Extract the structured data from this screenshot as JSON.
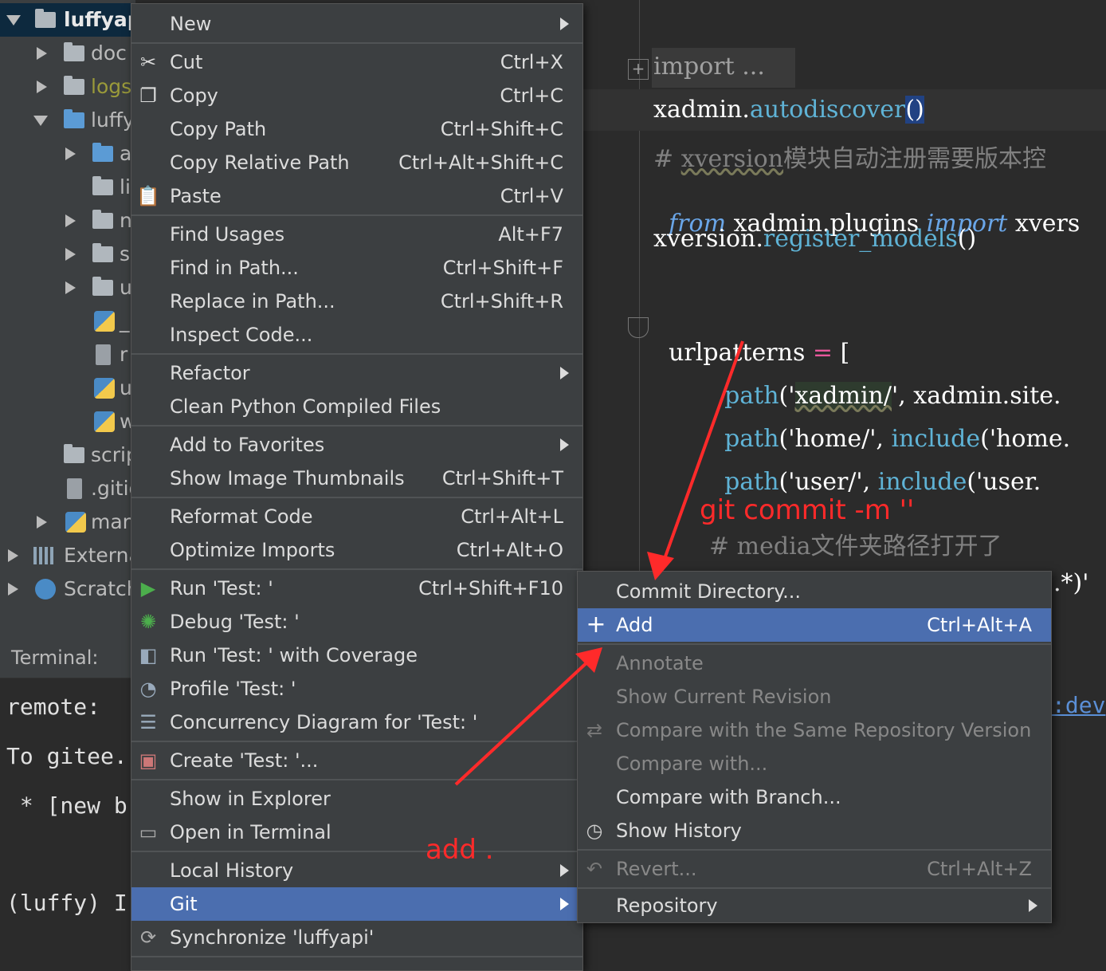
{
  "tree": {
    "root": "luffyap",
    "items": [
      "doc",
      "logs",
      "luffy",
      "a",
      "li",
      "n",
      "s",
      "u",
      "_",
      "r",
      "u",
      "w",
      "scrip",
      ".gitig",
      "man",
      "Externa",
      "Scratch"
    ]
  },
  "terminal": {
    "tab": "Terminal:",
    "lines": [
      "remote:",
      "To gitee.",
      " * [new b",
      "(luffy) I"
    ]
  },
  "editor": {
    "l1": "import ...",
    "l2a": "xadmin.",
    "l2b": "autodiscover",
    "l2c": "()",
    "l3a": "# ",
    "l3b": "xversion",
    "l3c": "模块自动注册需要版本控",
    "l4a": "from",
    "l4b": " xadmin.plugins ",
    "l4c": "import",
    "l4d": " xvers",
    "l5a": "xversion.",
    "l5b": "register_models",
    "l5c": "()",
    "l6a": "urlpatterns",
    "l6b": " = ",
    "l6c": "[",
    "l7a": "path",
    "l7b": "('",
    "l7c": "xadmin/",
    "l7d": "', xadmin.site.",
    "l8a": "path",
    "l8b": "('home/', ",
    "l8c": "include",
    "l8d": "('home.",
    "l9a": "path",
    "l9b": "('user/', ",
    "l9c": "include",
    "l9d": "('user.",
    "l10": "# media文件夹路径打开了",
    "l11": ".*)'",
    "link": ":dev"
  },
  "main_menu": {
    "items": [
      {
        "label": "New",
        "shortcut": "",
        "submenu": true
      },
      {
        "label": "Cut",
        "shortcut": "Ctrl+X"
      },
      {
        "label": "Copy",
        "shortcut": "Ctrl+C"
      },
      {
        "label": "Copy Path",
        "shortcut": "Ctrl+Shift+C"
      },
      {
        "label": "Copy Relative Path",
        "shortcut": "Ctrl+Alt+Shift+C"
      },
      {
        "label": "Paste",
        "shortcut": "Ctrl+V"
      },
      {
        "label": "Find Usages",
        "shortcut": "Alt+F7"
      },
      {
        "label": "Find in Path...",
        "shortcut": "Ctrl+Shift+F"
      },
      {
        "label": "Replace in Path...",
        "shortcut": "Ctrl+Shift+R"
      },
      {
        "label": "Inspect Code...",
        "shortcut": ""
      },
      {
        "label": "Refactor",
        "shortcut": "",
        "submenu": true
      },
      {
        "label": "Clean Python Compiled Files",
        "shortcut": ""
      },
      {
        "label": "Add to Favorites",
        "shortcut": "",
        "submenu": true
      },
      {
        "label": "Show Image Thumbnails",
        "shortcut": "Ctrl+Shift+T"
      },
      {
        "label": "Reformat Code",
        "shortcut": "Ctrl+Alt+L"
      },
      {
        "label": "Optimize Imports",
        "shortcut": "Ctrl+Alt+O"
      },
      {
        "label": "Run 'Test: '",
        "shortcut": "Ctrl+Shift+F10"
      },
      {
        "label": "Debug 'Test: '",
        "shortcut": ""
      },
      {
        "label": "Run 'Test: ' with Coverage",
        "shortcut": ""
      },
      {
        "label": "Profile 'Test: '",
        "shortcut": ""
      },
      {
        "label": "Concurrency Diagram for 'Test: '",
        "shortcut": ""
      },
      {
        "label": "Create 'Test: '...",
        "shortcut": ""
      },
      {
        "label": "Show in Explorer",
        "shortcut": ""
      },
      {
        "label": "Open in Terminal",
        "shortcut": ""
      },
      {
        "label": "Local History",
        "shortcut": "",
        "submenu": true
      },
      {
        "label": "Git",
        "shortcut": "",
        "submenu": true,
        "selected": true
      },
      {
        "label": "Synchronize 'luffyapi'",
        "shortcut": ""
      }
    ]
  },
  "git_menu": {
    "items": [
      {
        "label": "Commit Directory...",
        "shortcut": ""
      },
      {
        "label": "Add",
        "shortcut": "Ctrl+Alt+A",
        "selected": true
      },
      {
        "label": "Annotate",
        "shortcut": "",
        "disabled": true
      },
      {
        "label": "Show Current Revision",
        "shortcut": "",
        "disabled": true
      },
      {
        "label": "Compare with the Same Repository Version",
        "shortcut": "",
        "disabled": true
      },
      {
        "label": "Compare with...",
        "shortcut": "",
        "disabled": true
      },
      {
        "label": "Compare with Branch...",
        "shortcut": ""
      },
      {
        "label": "Show History",
        "shortcut": ""
      },
      {
        "label": "Revert...",
        "shortcut": "Ctrl+Alt+Z",
        "disabled": true
      },
      {
        "label": "Repository",
        "shortcut": "",
        "submenu": true
      }
    ]
  },
  "annotations": {
    "commit": "git commit -m ''",
    "add": "add ."
  },
  "colors": {
    "selection": "#4b6eaf",
    "annotation": "#ff2a2a",
    "menu_bg": "#3c3f41",
    "editor_bg": "#2b2b2b"
  }
}
